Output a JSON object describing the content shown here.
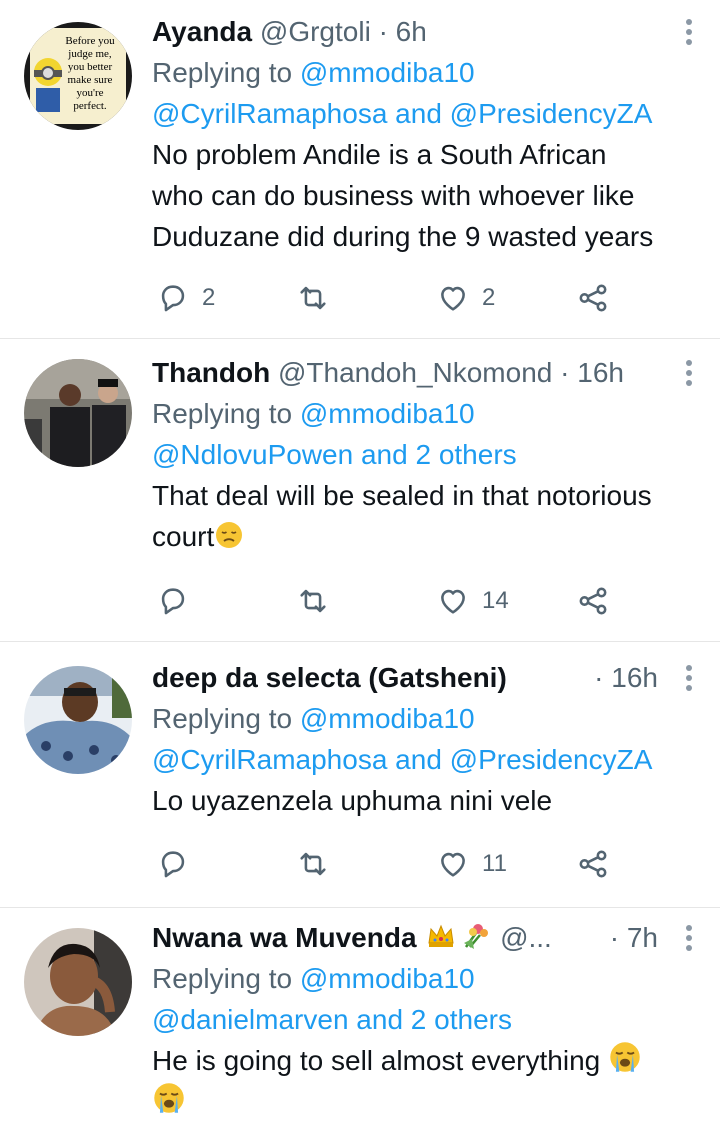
{
  "tweets": [
    {
      "name": "Ayanda",
      "handle": "@Grgtoli",
      "time": "· 6h",
      "replying_label": "Replying to",
      "reply_to_1": "@mmodiba10",
      "reply_to_2": "@CyrilRamaphosa and @PresidencyZA",
      "body": [
        "No problem Andile is a South African",
        "who can do business with whoever like",
        "Duduzane did during the 9 wasted years"
      ],
      "replies": "2",
      "retweets": "",
      "likes": "2",
      "avatar_text": [
        "Before you",
        "judge me,",
        "you better",
        "make sure",
        "you're",
        "perfect."
      ]
    },
    {
      "name": "Thandoh",
      "handle": "@Thandoh_Nkomond",
      "time": "· 16h",
      "replying_label": "Replying to",
      "reply_to_1": "@mmodiba10",
      "reply_to_2": "@NdlovuPowen and 2 others",
      "body": [
        "That deal will be sealed in that notorious",
        "court"
      ],
      "replies": "",
      "retweets": "",
      "likes": "14"
    },
    {
      "name": "deep da selecta (Gatsheni)",
      "handle": "",
      "time": "· 16h",
      "replying_label": "Replying to",
      "reply_to_1": "@mmodiba10",
      "reply_to_2": "@CyrilRamaphosa and @PresidencyZA",
      "body": [
        "Lo uyazenzela uphuma nini vele"
      ],
      "replies": "",
      "retweets": "",
      "likes": "11"
    },
    {
      "name": "Nwana wa Muvenda",
      "handle": "@...",
      "time": "· 7h",
      "replying_label": "Replying to",
      "reply_to_1": "@mmodiba10",
      "reply_to_2": "@danielmarven and 2 others",
      "body": [
        "He is going to sell almost everything"
      ],
      "replies": "",
      "retweets": "",
      "likes": ""
    }
  ],
  "colors": {
    "link": "#1d9bf0",
    "muted": "#536471",
    "text": "#0f1419",
    "divider": "#e6e6e6"
  },
  "icons": [
    "reply-icon",
    "retweet-icon",
    "like-icon",
    "share-icon",
    "more-icon"
  ]
}
